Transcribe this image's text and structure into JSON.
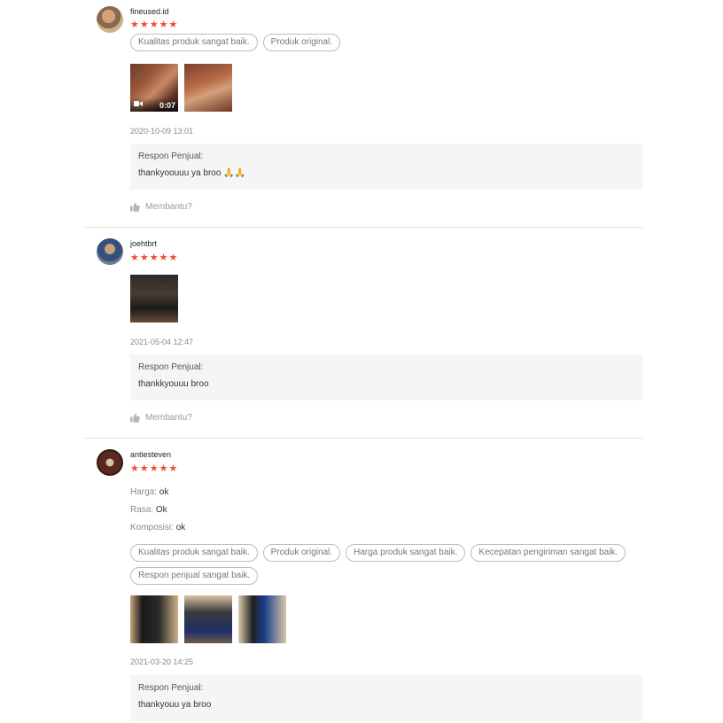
{
  "reviews": [
    {
      "username": "fineused.id",
      "stars": "★★★★★",
      "tags": [
        "Kualitas produk sangat baik.",
        "Produk original."
      ],
      "video_duration": "0:07",
      "timestamp": "2020-10-09 13:01",
      "response_label": "Respon Penjual:",
      "response_text": "thankyoouuu ya broo 🙏🙏",
      "helpful": "Membantu?"
    },
    {
      "username": "joehtbrt",
      "stars": "★★★★★",
      "timestamp": "2021-05-04 12:47",
      "response_label": "Respon Penjual:",
      "response_text": "thankkyouuu broo",
      "helpful": "Membantu?"
    },
    {
      "username": "antiesteven",
      "stars": "★★★★★",
      "attributes": [
        {
          "key": "Harga:",
          "value": "ok"
        },
        {
          "key": "Rasa:",
          "value": "Ok"
        },
        {
          "key": "Komposisi:",
          "value": "ok"
        }
      ],
      "tags": [
        "Kualitas produk sangat baik.",
        "Produk original.",
        "Harga produk sangat baik.",
        "Kecepatan pengiriman sangat baik.",
        "Respon penjual sangat baik."
      ],
      "timestamp": "2021-03-20 14:25",
      "response_label": "Respon Penjual:",
      "response_text": "thankyouu ya broo"
    }
  ],
  "colors": {
    "star": "#ee4d2d",
    "response_bg": "#f5f5f5",
    "divider": "#e5e5e5"
  },
  "icons": {
    "thumbs_up": "thumbs-up-icon",
    "video": "video-camera-icon"
  }
}
